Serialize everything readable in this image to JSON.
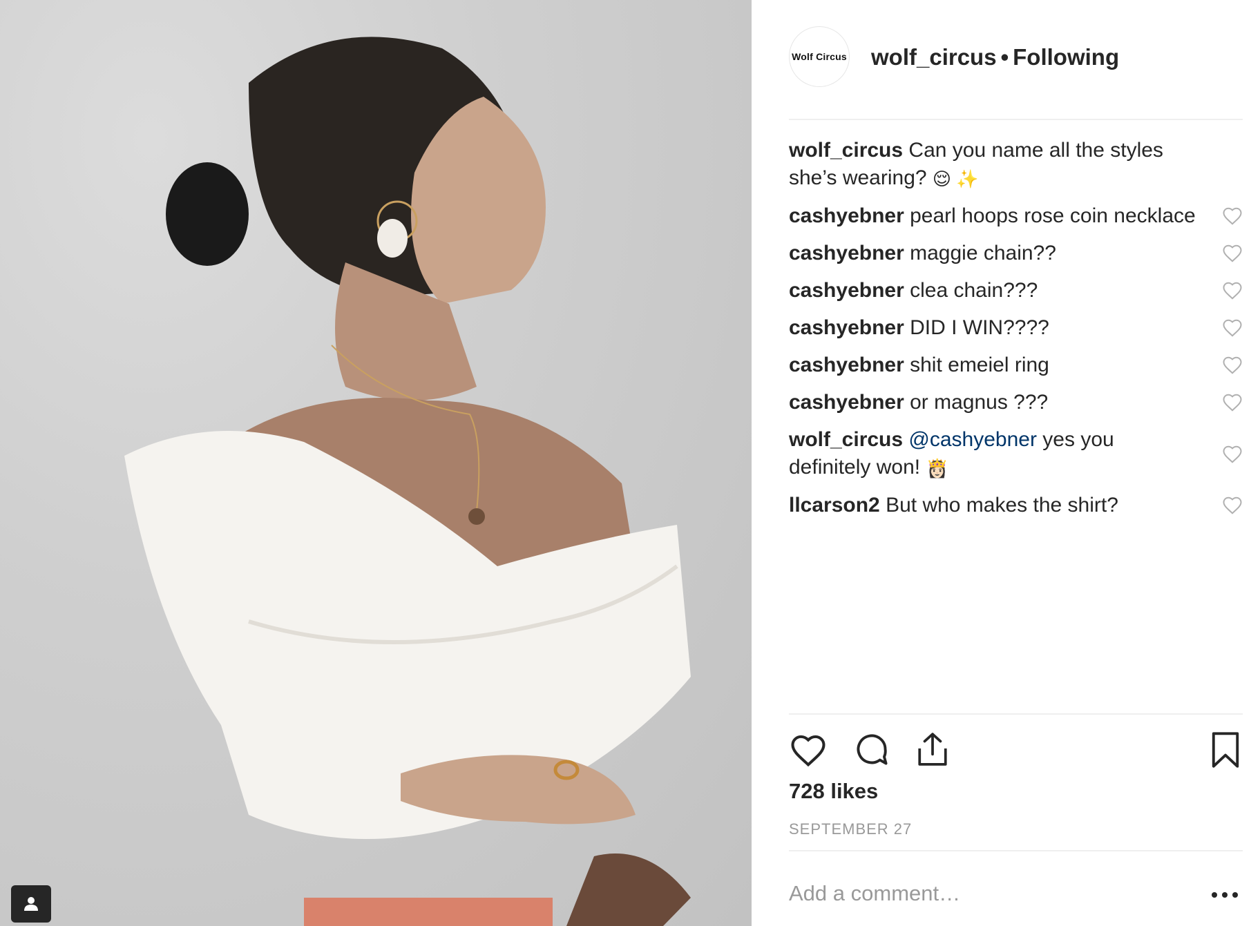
{
  "post": {
    "username": "wolf_circus",
    "avatar_text": "Wolf Circus",
    "separator": "•",
    "follow_status": "Following"
  },
  "comments": [
    {
      "user": "wolf_circus",
      "text": "Can you name all the styles she’s wearing? ",
      "emoji": "😌 ✨",
      "likeable": false
    },
    {
      "user": "cashyebner",
      "text": "pearl hoops rose coin necklace",
      "likeable": true
    },
    {
      "user": "cashyebner",
      "text": "maggie chain??",
      "likeable": true
    },
    {
      "user": "cashyebner",
      "text": "clea chain???",
      "likeable": true
    },
    {
      "user": "cashyebner",
      "text": "DID I WIN????",
      "likeable": true
    },
    {
      "user": "cashyebner",
      "text": "shit emeiel ring",
      "likeable": true
    },
    {
      "user": "cashyebner",
      "text": "or magnus ???",
      "likeable": true
    },
    {
      "user": "wolf_circus",
      "mention": "@cashyebner",
      "text": " yes you definitely won! ",
      "emoji": "👸🏻",
      "likeable": true
    },
    {
      "user": "llcarson2",
      "text": "But who makes the shirt?",
      "likeable": true
    }
  ],
  "stats": {
    "likes": "728 likes",
    "date": "SEPTEMBER 27"
  },
  "composer": {
    "placeholder": "Add a comment…"
  },
  "icons": {
    "like": "heart-icon",
    "comment": "comment-bubble-icon",
    "share": "share-icon",
    "save": "bookmark-icon",
    "more": "more-options-icon",
    "tag": "user-tag-icon"
  },
  "colors": {
    "text": "#262626",
    "muted": "#999999",
    "mention": "#003569",
    "divider": "#efefef"
  }
}
